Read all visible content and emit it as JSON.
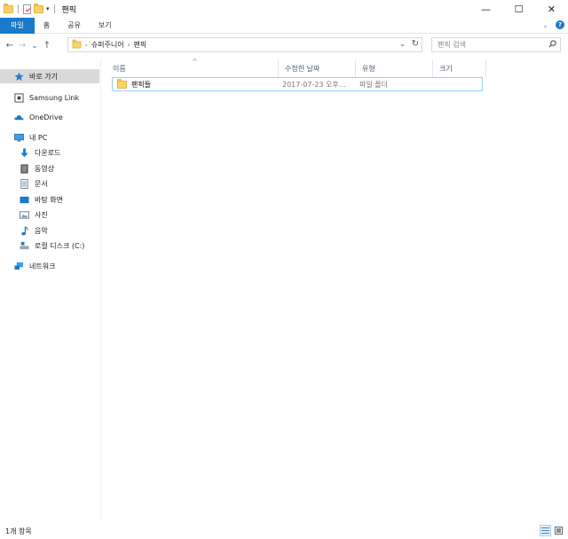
{
  "window": {
    "title": "팬픽",
    "minimize_glyph": "—",
    "maximize_glyph": "☐",
    "close_glyph": "✕"
  },
  "qat": {
    "dropdown_glyph": "▾"
  },
  "ribbon": {
    "tabs": [
      "파일",
      "홈",
      "공유",
      "보기"
    ],
    "expand_glyph": "⌄",
    "help_glyph": "?"
  },
  "nav": {
    "back": "←",
    "forward": "→",
    "recent": "⌄",
    "up": "↑"
  },
  "address": {
    "separator": "›",
    "crumbs": [
      "슈퍼주니어",
      "팬픽"
    ],
    "dropdown_glyph": "⌄",
    "refresh_glyph": "↻"
  },
  "search": {
    "placeholder": "팬픽 검색"
  },
  "sidebar": {
    "items": [
      {
        "label": "바로 가기",
        "icon": "star-icon",
        "selected": true
      },
      {
        "label": "Samsung Link",
        "icon": "samsung-link-icon"
      },
      {
        "label": "OneDrive",
        "icon": "onedrive-icon"
      },
      {
        "label": "내 PC",
        "icon": "pc-icon"
      },
      {
        "label": "다운로드",
        "icon": "download-icon"
      },
      {
        "label": "동영상",
        "icon": "video-icon"
      },
      {
        "label": "문서",
        "icon": "document-icon"
      },
      {
        "label": "바탕 화면",
        "icon": "desktop-icon"
      },
      {
        "label": "사진",
        "icon": "pictures-icon"
      },
      {
        "label": "음악",
        "icon": "music-icon"
      },
      {
        "label": "로컬 디스크 (C:)",
        "icon": "disk-icon"
      },
      {
        "label": "네트워크",
        "icon": "network-icon"
      }
    ]
  },
  "columns": {
    "name": "이름",
    "date": "수정한 날짜",
    "type": "유형",
    "size": "크기",
    "sort_glyph": "^"
  },
  "files": [
    {
      "name": "팬픽들",
      "date": "2017-07-23 오후...",
      "type": "파일 폴더",
      "icon": "folder-icon"
    }
  ],
  "status": {
    "item_count": "1개 항목"
  },
  "colors": {
    "accent": "#1979ca",
    "selection_border": "#99d1ff",
    "folder": "#f8d26a"
  }
}
